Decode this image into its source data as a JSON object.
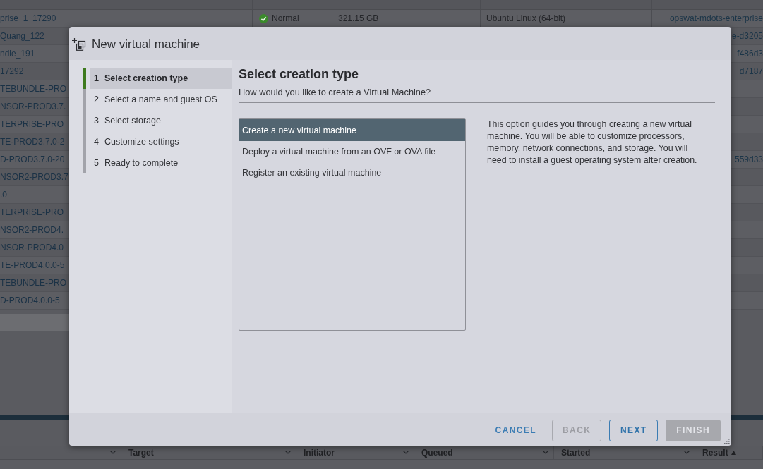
{
  "background": {
    "vm_table": {
      "rows": [
        {
          "name": "prise_1_17290",
          "status": "Normal",
          "used_space": "321.15 GB",
          "guest_os": "Ubuntu Linux (64-bit)",
          "host_name": "opswat-mdots-enterprise"
        },
        {
          "name": "Quang_122",
          "host_name": "e-d3205"
        },
        {
          "name": "ndle_191",
          "host_name": "f486d3"
        },
        {
          "name": "17292",
          "host_name": "d7187"
        },
        {
          "name": "TEBUNDLE-PRO"
        },
        {
          "name": "NSOR-PROD3.7."
        },
        {
          "name": "TERPRISE-PRO"
        },
        {
          "name": "TE-PROD3.7.0-2"
        },
        {
          "name": "D-PROD3.7.0-20",
          "host_name": "559d33"
        },
        {
          "name": "NSOR2-PROD3.7"
        },
        {
          "name": ".0"
        },
        {
          "name": "TERPRISE-PRO"
        },
        {
          "name": "NSOR2-PROD4."
        },
        {
          "name": "NSOR-PROD4.0"
        },
        {
          "name": "TE-PROD4.0.0-5"
        },
        {
          "name": "TEBUNDLE-PRO"
        },
        {
          "name": "D-PROD4.0.0-5"
        }
      ]
    },
    "tasks_table": {
      "columns": [
        {
          "label": "Target",
          "sorted": false
        },
        {
          "label": "Initiator",
          "sorted": false
        },
        {
          "label": "Queued",
          "sorted": false
        },
        {
          "label": "Started",
          "sorted": false
        },
        {
          "label": "Result",
          "sorted": true
        }
      ]
    }
  },
  "dialog": {
    "title": "New virtual machine",
    "steps": [
      {
        "number": "1",
        "label": "Select creation type",
        "selected": true
      },
      {
        "number": "2",
        "label": "Select a name and guest OS",
        "selected": false
      },
      {
        "number": "3",
        "label": "Select storage",
        "selected": false
      },
      {
        "number": "4",
        "label": "Customize settings",
        "selected": false
      },
      {
        "number": "5",
        "label": "Ready to complete",
        "selected": false
      }
    ],
    "page": {
      "heading": "Select creation type",
      "subtitle": "How would you like to create a Virtual Machine?",
      "options": [
        {
          "label": "Create a new virtual machine",
          "selected": true
        },
        {
          "label": "Deploy a virtual machine from an OVF or OVA file",
          "selected": false
        },
        {
          "label": "Register an existing virtual machine",
          "selected": false
        }
      ],
      "description": "This option guides you through creating a new virtual machine. You will be able to customize processors, memory, network connections, and storage. You will need to install a guest operating system after creation."
    },
    "buttons": [
      {
        "label": "CANCEL",
        "kind": "flat",
        "disabled": false
      },
      {
        "label": "BACK",
        "kind": "outline",
        "disabled": true
      },
      {
        "label": "NEXT",
        "kind": "outline",
        "disabled": false
      },
      {
        "label": "FINISH",
        "kind": "solid",
        "disabled": true
      }
    ]
  }
}
